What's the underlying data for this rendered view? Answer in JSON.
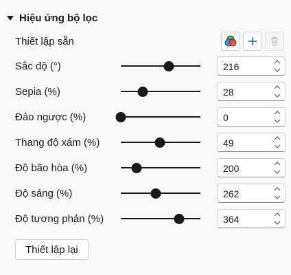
{
  "section": {
    "title": "Hiệu ứng bộ lọc",
    "preset_label": "Thiết lập sẵn",
    "preset_icons": [
      "color-circles-icon",
      "plus-icon",
      "trash-icon"
    ]
  },
  "filters": [
    {
      "label": "Sắc độ (°)",
      "value": "216",
      "slider_fraction": 0.6
    },
    {
      "label": "Sepia (%)",
      "value": "28",
      "slider_fraction": 0.28
    },
    {
      "label": "Đảo ngược (%)",
      "value": "0",
      "slider_fraction": 0.0
    },
    {
      "label": "Thang độ xám (%)",
      "value": "49",
      "slider_fraction": 0.49
    },
    {
      "label": "Độ bão hòa (%)",
      "value": "200",
      "slider_fraction": 0.2
    },
    {
      "label": "Độ sáng (%)",
      "value": "262",
      "slider_fraction": 0.44
    },
    {
      "label": "Độ tương phản (%)",
      "value": "364",
      "slider_fraction": 0.73
    }
  ],
  "reset_label": "Thiết lập lại",
  "colors": {
    "accent": "#1a1a1a",
    "add_icon": "#0067c0"
  }
}
